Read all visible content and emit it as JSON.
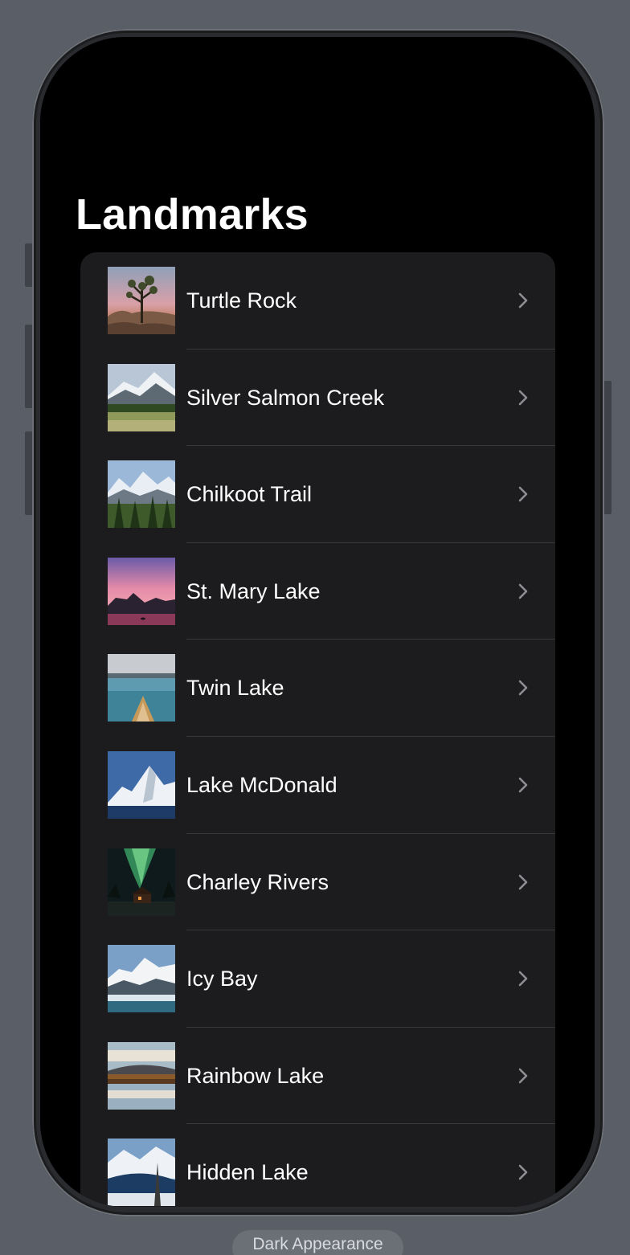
{
  "navigation": {
    "title": "Landmarks"
  },
  "landmarks": [
    {
      "name": "Turtle Rock",
      "icon": "turtle-rock-photo"
    },
    {
      "name": "Silver Salmon Creek",
      "icon": "silver-salmon-creek-photo"
    },
    {
      "name": "Chilkoot Trail",
      "icon": "chilkoot-trail-photo"
    },
    {
      "name": "St. Mary Lake",
      "icon": "st-mary-lake-photo"
    },
    {
      "name": "Twin Lake",
      "icon": "twin-lake-photo"
    },
    {
      "name": "Lake McDonald",
      "icon": "lake-mcdonald-photo"
    },
    {
      "name": "Charley Rivers",
      "icon": "charley-rivers-photo"
    },
    {
      "name": "Icy Bay",
      "icon": "icy-bay-photo"
    },
    {
      "name": "Rainbow Lake",
      "icon": "rainbow-lake-photo"
    },
    {
      "name": "Hidden Lake",
      "icon": "hidden-lake-photo"
    }
  ],
  "preview": {
    "appearance_label": "Dark Appearance"
  },
  "colors": {
    "background": "#000000",
    "list_background": "#1c1c1e",
    "separator": "#38383a",
    "chevron": "#8e8e93",
    "text": "#ffffff"
  }
}
